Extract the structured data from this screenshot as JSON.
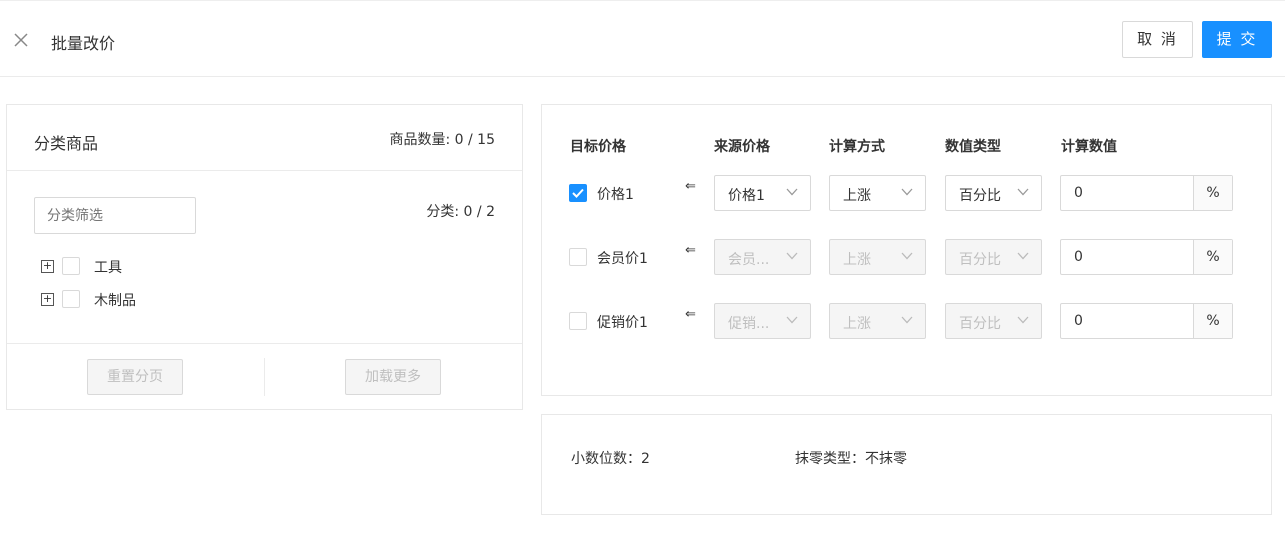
{
  "header": {
    "close_icon": "close-icon",
    "title": "批量改价",
    "cancel_label": "取 消",
    "submit_label": "提 交",
    "accent": "#1890ff"
  },
  "category_panel": {
    "title": "分类商品",
    "goods_count": "商品数量: 0 / 15",
    "filter_placeholder": "分类筛选",
    "category_count": "分类: 0 / 2",
    "tree": [
      {
        "label": "工具",
        "checked": false
      },
      {
        "label": "木制品",
        "checked": false
      }
    ],
    "reset_label": "重置分页",
    "load_more_label": "加载更多"
  },
  "price_table": {
    "headers": {
      "target": "目标价格",
      "source": "来源价格",
      "method": "计算方式",
      "value_type": "数值类型",
      "value": "计算数值"
    },
    "rows": [
      {
        "label": "价格1",
        "checked": true,
        "arrow": "⇐",
        "source": "价格1",
        "method": "上涨",
        "value_type": "百分比",
        "value": "0",
        "unit": "%",
        "disabled": false
      },
      {
        "label": "会员价1",
        "checked": false,
        "arrow": "⇐",
        "source": "会员...",
        "method": "上涨",
        "value_type": "百分比",
        "value": "0",
        "unit": "%",
        "disabled": true
      },
      {
        "label": "促销价1",
        "checked": false,
        "arrow": "⇐",
        "source": "促销...",
        "method": "上涨",
        "value_type": "百分比",
        "value": "0",
        "unit": "%",
        "disabled": true
      }
    ]
  },
  "settings": {
    "decimals": "小数位数：2",
    "rounding": "抹零类型：不抹零"
  }
}
